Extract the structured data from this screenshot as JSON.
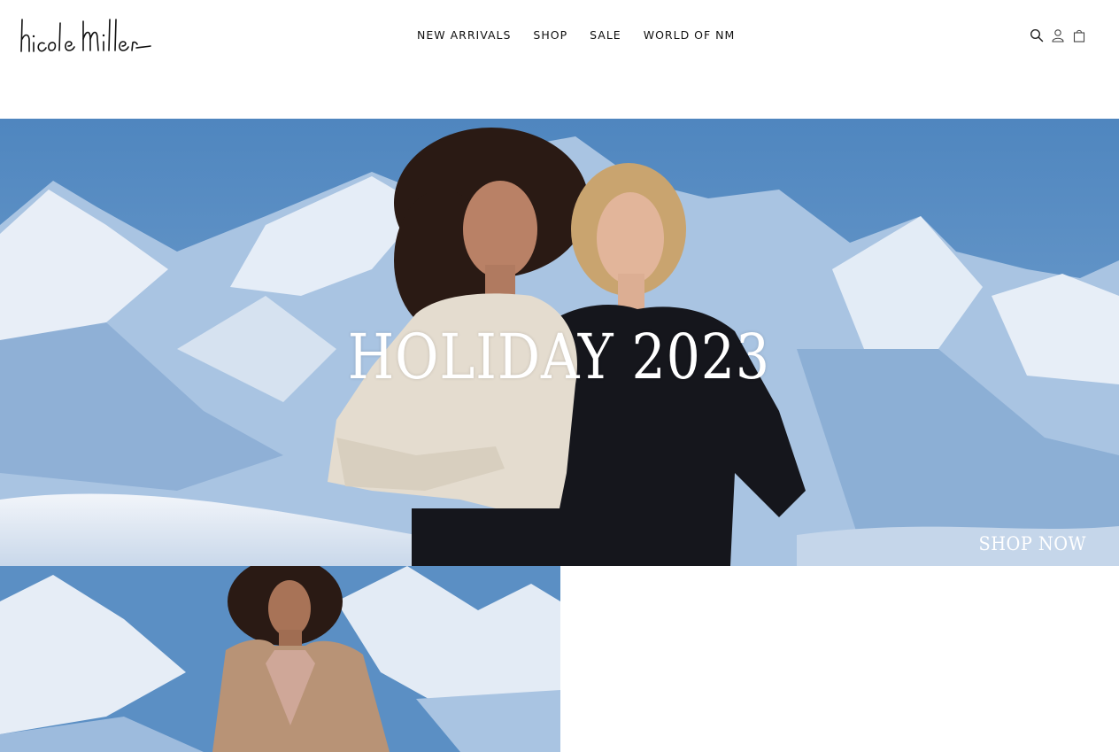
{
  "brand": {
    "logo_text": "nicole miller"
  },
  "nav": {
    "items": [
      {
        "label": "NEW ARRIVALS"
      },
      {
        "label": "SHOP"
      },
      {
        "label": "SALE"
      },
      {
        "label": "WORLD OF NM"
      }
    ]
  },
  "header_icons": [
    "search-icon",
    "account-icon",
    "bag-icon"
  ],
  "hero": {
    "title": "HOLIDAY 2023",
    "cta": "SHOP NOW"
  },
  "colors": {
    "sky": "#5b8fc4",
    "snow": "#e9eef5",
    "text_dark": "#111111",
    "white": "#ffffff"
  }
}
